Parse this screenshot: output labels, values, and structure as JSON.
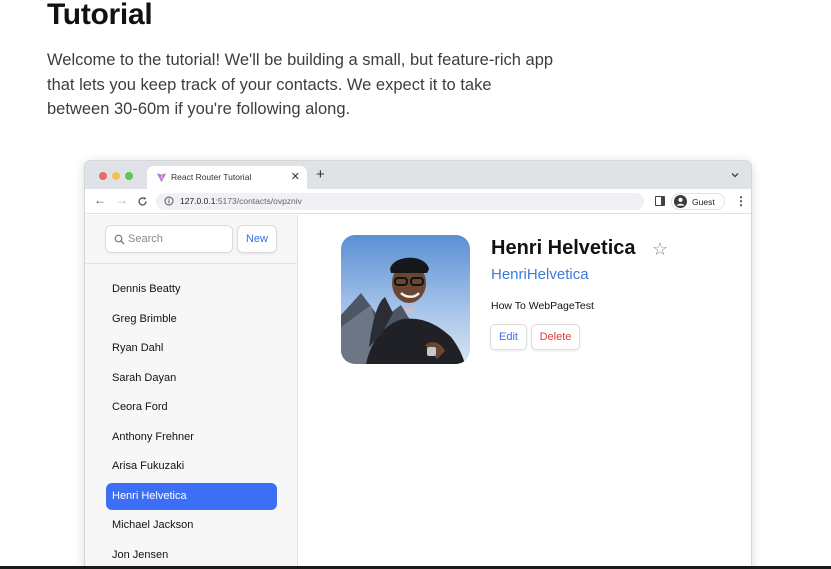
{
  "article": {
    "title": "Tutorial",
    "intro": "Welcome to the tutorial! We'll be building a small, but feature-rich app that lets you keep track of your contacts. We expect it to take between 30-60m if you're following along."
  },
  "browser": {
    "tab_title": "React Router Tutorial",
    "url_host": "127.0.0.1",
    "url_path": ":5173/contacts/ovpzniv",
    "profile_label": "Guest"
  },
  "sidebar": {
    "search_placeholder": "Search",
    "new_label": "New",
    "contacts": [
      {
        "name": "Dennis Beatty",
        "active": false
      },
      {
        "name": "Greg Brimble",
        "active": false
      },
      {
        "name": "Ryan Dahl",
        "active": false
      },
      {
        "name": "Sarah Dayan",
        "active": false
      },
      {
        "name": "Ceora Ford",
        "active": false
      },
      {
        "name": "Anthony Frehner",
        "active": false
      },
      {
        "name": "Arisa Fukuzaki",
        "active": false
      },
      {
        "name": "Henri Helvetica",
        "active": true
      },
      {
        "name": "Michael Jackson",
        "active": false
      },
      {
        "name": "Jon Jensen",
        "active": false
      }
    ]
  },
  "contact": {
    "name": "Henri Helvetica",
    "twitter": "HenriHelvetica",
    "notes": "How To WebPageTest",
    "edit_label": "Edit",
    "delete_label": "Delete",
    "favorite_icon": "star-outline-icon"
  },
  "colors": {
    "accent": "#3d6ef6",
    "link": "#3d7bd9",
    "danger": "#d83b3b"
  }
}
